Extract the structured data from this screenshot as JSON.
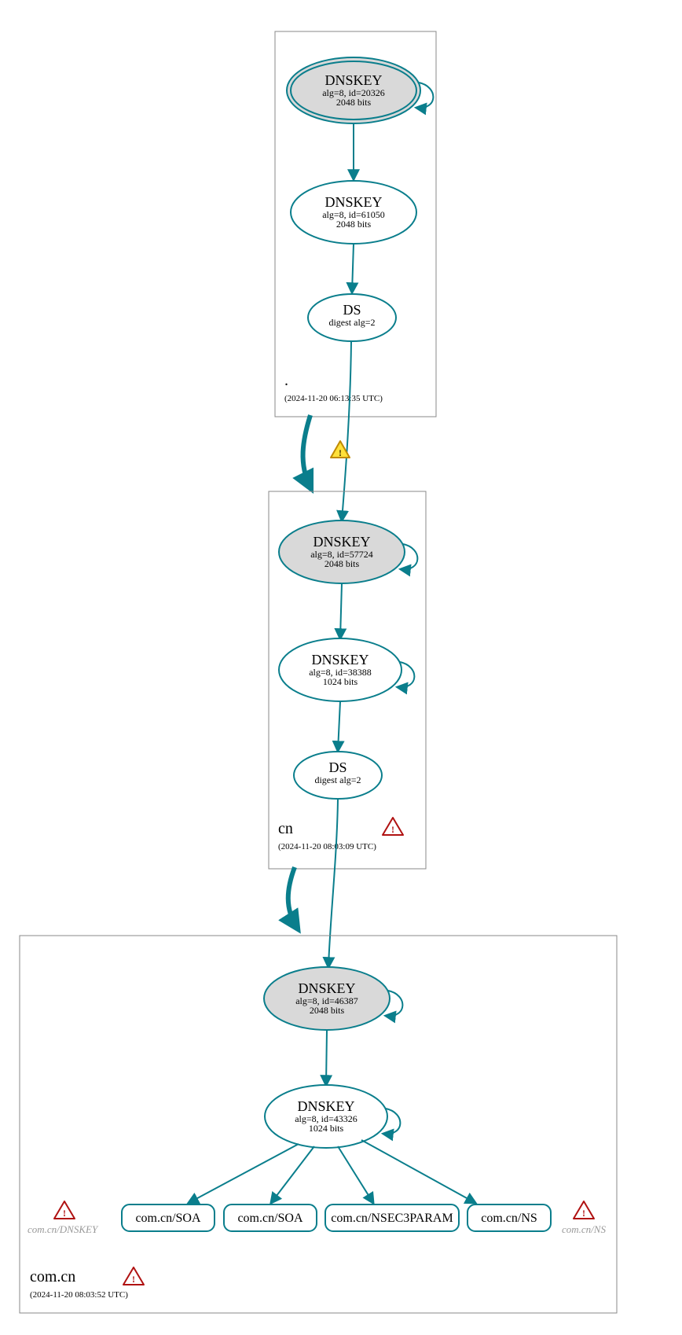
{
  "zones": {
    "root": {
      "name": ".",
      "timestamp": "(2024-11-20 06:13:35 UTC)",
      "ksk": {
        "title": "DNSKEY",
        "alg": "alg=8, id=20326",
        "bits": "2048 bits"
      },
      "zsk": {
        "title": "DNSKEY",
        "alg": "alg=8, id=61050",
        "bits": "2048 bits"
      },
      "ds": {
        "title": "DS",
        "digest": "digest alg=2"
      }
    },
    "cn": {
      "name": "cn",
      "timestamp": "(2024-11-20 08:03:09 UTC)",
      "ksk": {
        "title": "DNSKEY",
        "alg": "alg=8, id=57724",
        "bits": "2048 bits"
      },
      "zsk": {
        "title": "DNSKEY",
        "alg": "alg=8, id=38388",
        "bits": "1024 bits"
      },
      "ds": {
        "title": "DS",
        "digest": "digest alg=2"
      }
    },
    "comcn": {
      "name": "com.cn",
      "timestamp": "(2024-11-20 08:03:52 UTC)",
      "ksk": {
        "title": "DNSKEY",
        "alg": "alg=8, id=46387",
        "bits": "2048 bits"
      },
      "zsk": {
        "title": "DNSKEY",
        "alg": "alg=8, id=43326",
        "bits": "1024 bits"
      },
      "ghostLeft": "com.cn/DNSKEY",
      "ghostRight": "com.cn/NS",
      "rr": [
        "com.cn/SOA",
        "com.cn/SOA",
        "com.cn/NSEC3PARAM",
        "com.cn/NS"
      ]
    }
  },
  "icons": {
    "warn": "!",
    "err": "!"
  }
}
